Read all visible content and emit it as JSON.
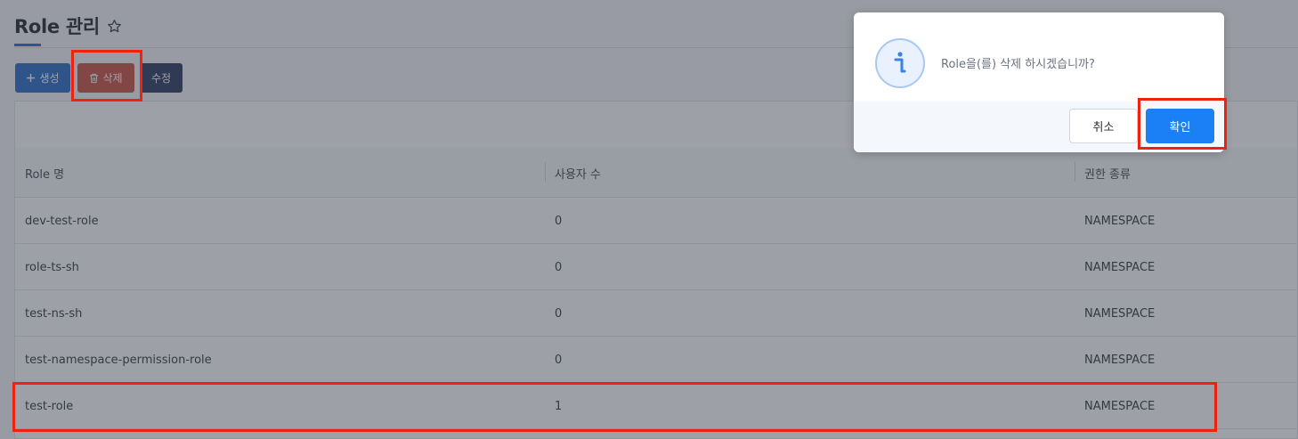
{
  "header": {
    "title": "Role 관리",
    "star_icon": "star-outline-icon"
  },
  "toolbar": {
    "create_label": "생성",
    "delete_label": "삭제",
    "edit_label": "수정",
    "create_icon": "plus-icon",
    "delete_icon": "trash-icon"
  },
  "table": {
    "columns": [
      "Role 명",
      "사용자 수",
      "권한 종류"
    ],
    "rows": [
      {
        "name": "dev-test-role",
        "users": "0",
        "type": "NAMESPACE"
      },
      {
        "name": "role-ts-sh",
        "users": "0",
        "type": "NAMESPACE"
      },
      {
        "name": "test-ns-sh",
        "users": "0",
        "type": "NAMESPACE"
      },
      {
        "name": "test-namespace-permission-role",
        "users": "0",
        "type": "NAMESPACE"
      },
      {
        "name": "test-role",
        "users": "1",
        "type": "NAMESPACE"
      }
    ]
  },
  "dialog": {
    "icon": "info-icon",
    "message": "Role을(를) 삭제 하시겠습니까?",
    "cancel_label": "취소",
    "confirm_label": "확인"
  },
  "colors": {
    "accent": "#2266c6",
    "danger": "#c84a3c",
    "confirm": "#1b7ff5",
    "highlight": "#f0220f"
  }
}
